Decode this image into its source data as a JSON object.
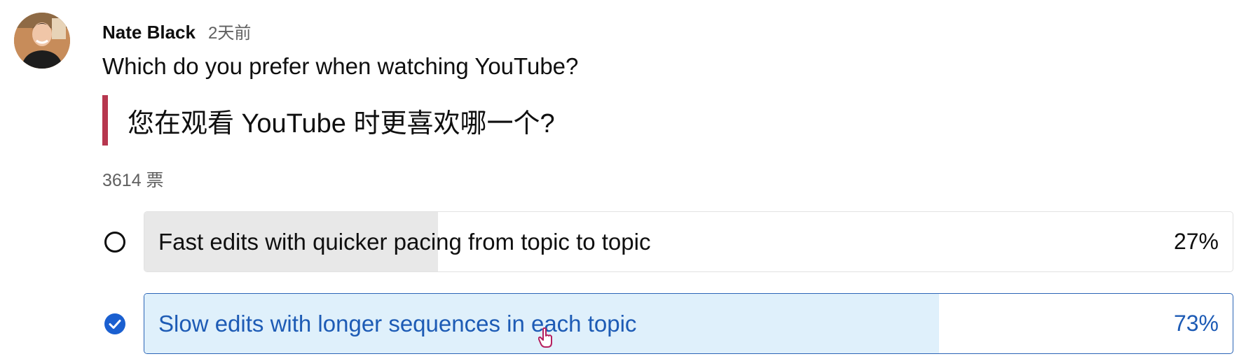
{
  "post": {
    "author": "Nate Black",
    "time": "2天前",
    "question": "Which do you prefer when watching YouTube?",
    "translation": "您在观看 YouTube 时更喜欢哪一个?",
    "vote_count": "3614 票"
  },
  "poll": {
    "options": [
      {
        "label": "Fast edits with quicker pacing from topic to topic",
        "percent": "27%",
        "fraction": 0.27,
        "selected": false
      },
      {
        "label": "Slow edits with longer sequences in each topic",
        "percent": "73%",
        "fraction": 0.73,
        "selected": true
      }
    ]
  },
  "colors": {
    "translation_accent": "#b7374f",
    "selected_accent": "#1a5fd0",
    "selected_text": "#1d5bb5",
    "selected_fill": "#dff0fb",
    "unselected_fill": "#e8e8e8"
  },
  "icons": {
    "avatar": "author-avatar",
    "unselected": "radio-unchecked-icon",
    "selected": "check-circle-icon",
    "cursor": "pointer-cursor-icon"
  }
}
